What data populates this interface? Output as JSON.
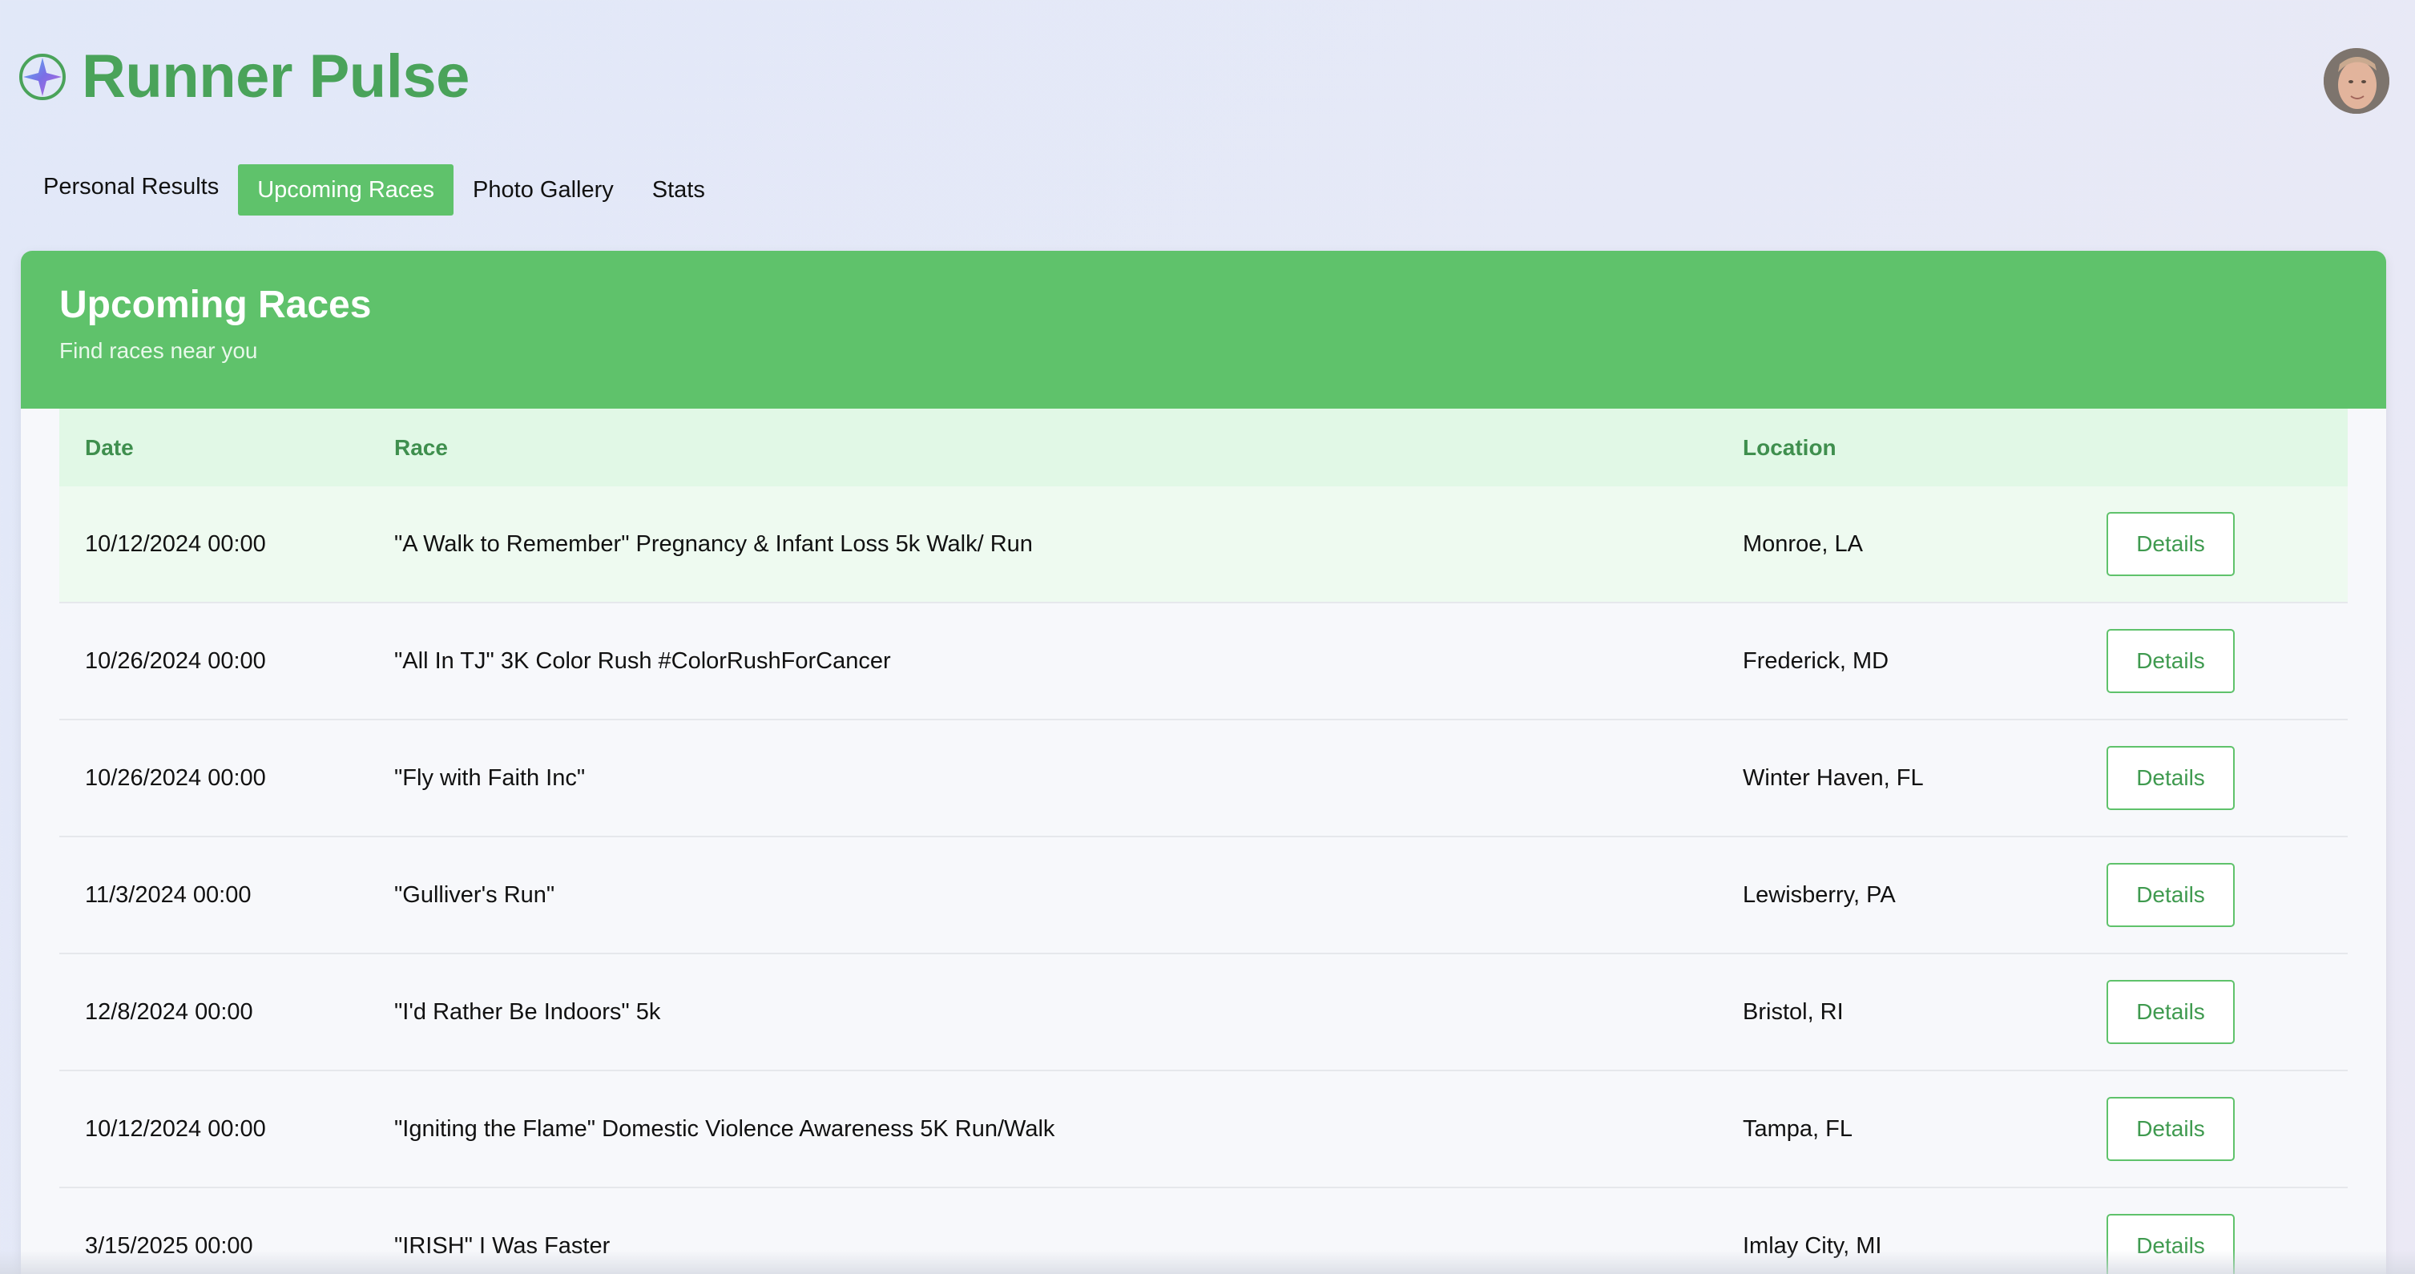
{
  "app": {
    "title": "Runner Pulse"
  },
  "nav": {
    "tabs": [
      {
        "label": "Personal Results",
        "active": false
      },
      {
        "label": "Upcoming Races",
        "active": true
      },
      {
        "label": "Photo Gallery",
        "active": false
      },
      {
        "label": "Stats",
        "active": false
      }
    ]
  },
  "panel": {
    "title": "Upcoming Races",
    "subtitle": "Find races near you"
  },
  "table": {
    "headers": {
      "date": "Date",
      "race": "Race",
      "location": "Location"
    },
    "rows": [
      {
        "date": "10/12/2024 00:00",
        "race": "\"A Walk to Remember\" Pregnancy & Infant Loss 5k Walk/ Run",
        "location": "Monroe, LA",
        "action": "Details"
      },
      {
        "date": "10/26/2024 00:00",
        "race": "\"All In TJ\" 3K Color Rush #ColorRushForCancer",
        "location": "Frederick, MD",
        "action": "Details"
      },
      {
        "date": "10/26/2024 00:00",
        "race": "\"Fly with Faith Inc\"",
        "location": "Winter Haven, FL",
        "action": "Details"
      },
      {
        "date": "11/3/2024 00:00",
        "race": "\"Gulliver's Run\"",
        "location": "Lewisberry, PA",
        "action": "Details"
      },
      {
        "date": "12/8/2024 00:00",
        "race": "\"I'd Rather Be Indoors\" 5k",
        "location": "Bristol, RI",
        "action": "Details"
      },
      {
        "date": "10/12/2024 00:00",
        "race": "\"Igniting the Flame\" Domestic Violence Awareness 5K Run/Walk",
        "location": "Tampa, FL",
        "action": "Details"
      },
      {
        "date": "3/15/2025 00:00",
        "race": "\"IRISH\" I Was Faster",
        "location": "Imlay City, MI",
        "action": "Details"
      }
    ]
  },
  "colors": {
    "brand": "#4aa35a",
    "accent": "#5fc26b",
    "header_row": "#e1f8e6"
  },
  "icons": {
    "logo": "compass-star-icon",
    "avatar": "user-avatar"
  }
}
